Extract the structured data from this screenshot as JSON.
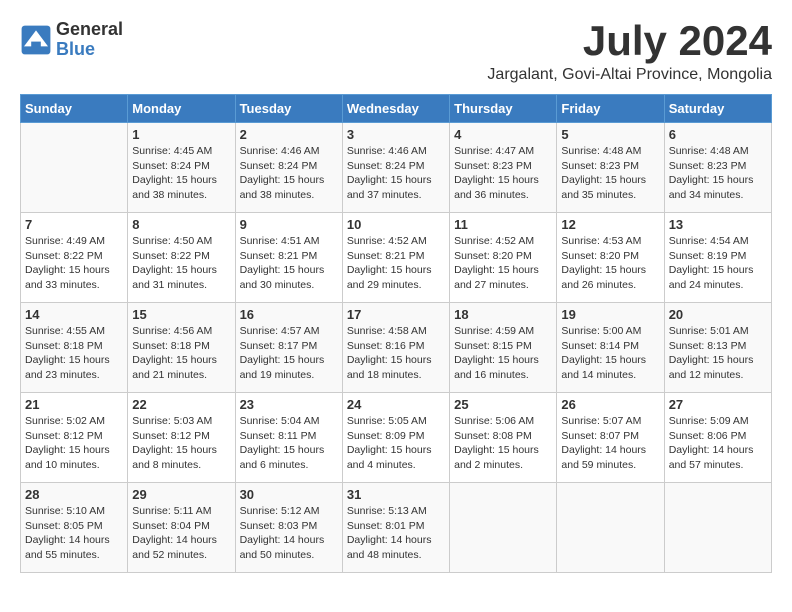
{
  "header": {
    "logo_general": "General",
    "logo_blue": "Blue",
    "month_title": "July 2024",
    "subtitle": "Jargalant, Govi-Altai Province, Mongolia"
  },
  "calendar": {
    "weekdays": [
      "Sunday",
      "Monday",
      "Tuesday",
      "Wednesday",
      "Thursday",
      "Friday",
      "Saturday"
    ],
    "weeks": [
      [
        {
          "day": "",
          "info": ""
        },
        {
          "day": "1",
          "info": "Sunrise: 4:45 AM\nSunset: 8:24 PM\nDaylight: 15 hours\nand 38 minutes."
        },
        {
          "day": "2",
          "info": "Sunrise: 4:46 AM\nSunset: 8:24 PM\nDaylight: 15 hours\nand 38 minutes."
        },
        {
          "day": "3",
          "info": "Sunrise: 4:46 AM\nSunset: 8:24 PM\nDaylight: 15 hours\nand 37 minutes."
        },
        {
          "day": "4",
          "info": "Sunrise: 4:47 AM\nSunset: 8:23 PM\nDaylight: 15 hours\nand 36 minutes."
        },
        {
          "day": "5",
          "info": "Sunrise: 4:48 AM\nSunset: 8:23 PM\nDaylight: 15 hours\nand 35 minutes."
        },
        {
          "day": "6",
          "info": "Sunrise: 4:48 AM\nSunset: 8:23 PM\nDaylight: 15 hours\nand 34 minutes."
        }
      ],
      [
        {
          "day": "7",
          "info": "Sunrise: 4:49 AM\nSunset: 8:22 PM\nDaylight: 15 hours\nand 33 minutes."
        },
        {
          "day": "8",
          "info": "Sunrise: 4:50 AM\nSunset: 8:22 PM\nDaylight: 15 hours\nand 31 minutes."
        },
        {
          "day": "9",
          "info": "Sunrise: 4:51 AM\nSunset: 8:21 PM\nDaylight: 15 hours\nand 30 minutes."
        },
        {
          "day": "10",
          "info": "Sunrise: 4:52 AM\nSunset: 8:21 PM\nDaylight: 15 hours\nand 29 minutes."
        },
        {
          "day": "11",
          "info": "Sunrise: 4:52 AM\nSunset: 8:20 PM\nDaylight: 15 hours\nand 27 minutes."
        },
        {
          "day": "12",
          "info": "Sunrise: 4:53 AM\nSunset: 8:20 PM\nDaylight: 15 hours\nand 26 minutes."
        },
        {
          "day": "13",
          "info": "Sunrise: 4:54 AM\nSunset: 8:19 PM\nDaylight: 15 hours\nand 24 minutes."
        }
      ],
      [
        {
          "day": "14",
          "info": "Sunrise: 4:55 AM\nSunset: 8:18 PM\nDaylight: 15 hours\nand 23 minutes."
        },
        {
          "day": "15",
          "info": "Sunrise: 4:56 AM\nSunset: 8:18 PM\nDaylight: 15 hours\nand 21 minutes."
        },
        {
          "day": "16",
          "info": "Sunrise: 4:57 AM\nSunset: 8:17 PM\nDaylight: 15 hours\nand 19 minutes."
        },
        {
          "day": "17",
          "info": "Sunrise: 4:58 AM\nSunset: 8:16 PM\nDaylight: 15 hours\nand 18 minutes."
        },
        {
          "day": "18",
          "info": "Sunrise: 4:59 AM\nSunset: 8:15 PM\nDaylight: 15 hours\nand 16 minutes."
        },
        {
          "day": "19",
          "info": "Sunrise: 5:00 AM\nSunset: 8:14 PM\nDaylight: 15 hours\nand 14 minutes."
        },
        {
          "day": "20",
          "info": "Sunrise: 5:01 AM\nSunset: 8:13 PM\nDaylight: 15 hours\nand 12 minutes."
        }
      ],
      [
        {
          "day": "21",
          "info": "Sunrise: 5:02 AM\nSunset: 8:12 PM\nDaylight: 15 hours\nand 10 minutes."
        },
        {
          "day": "22",
          "info": "Sunrise: 5:03 AM\nSunset: 8:12 PM\nDaylight: 15 hours\nand 8 minutes."
        },
        {
          "day": "23",
          "info": "Sunrise: 5:04 AM\nSunset: 8:11 PM\nDaylight: 15 hours\nand 6 minutes."
        },
        {
          "day": "24",
          "info": "Sunrise: 5:05 AM\nSunset: 8:09 PM\nDaylight: 15 hours\nand 4 minutes."
        },
        {
          "day": "25",
          "info": "Sunrise: 5:06 AM\nSunset: 8:08 PM\nDaylight: 15 hours\nand 2 minutes."
        },
        {
          "day": "26",
          "info": "Sunrise: 5:07 AM\nSunset: 8:07 PM\nDaylight: 14 hours\nand 59 minutes."
        },
        {
          "day": "27",
          "info": "Sunrise: 5:09 AM\nSunset: 8:06 PM\nDaylight: 14 hours\nand 57 minutes."
        }
      ],
      [
        {
          "day": "28",
          "info": "Sunrise: 5:10 AM\nSunset: 8:05 PM\nDaylight: 14 hours\nand 55 minutes."
        },
        {
          "day": "29",
          "info": "Sunrise: 5:11 AM\nSunset: 8:04 PM\nDaylight: 14 hours\nand 52 minutes."
        },
        {
          "day": "30",
          "info": "Sunrise: 5:12 AM\nSunset: 8:03 PM\nDaylight: 14 hours\nand 50 minutes."
        },
        {
          "day": "31",
          "info": "Sunrise: 5:13 AM\nSunset: 8:01 PM\nDaylight: 14 hours\nand 48 minutes."
        },
        {
          "day": "",
          "info": ""
        },
        {
          "day": "",
          "info": ""
        },
        {
          "day": "",
          "info": ""
        }
      ]
    ]
  }
}
